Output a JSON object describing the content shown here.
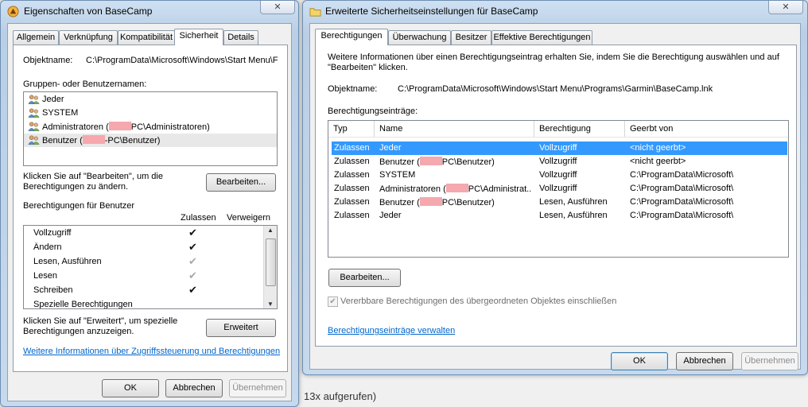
{
  "background": {
    "snippet": "13x aufgerufen)"
  },
  "props": {
    "title": "Eigenschaften von BaseCamp",
    "close": "✕",
    "tabs": [
      "Allgemein",
      "Verknüpfung",
      "Kompatibilität",
      "Sicherheit",
      "Details"
    ],
    "object_label": "Objektname:",
    "object_value": "C:\\ProgramData\\Microsoft\\Windows\\Start Menu\\F",
    "groups_label": "Gruppen- oder Benutzernamen:",
    "groups": [
      {
        "pre": "Jeder",
        "post": "",
        "redacted": false
      },
      {
        "pre": "SYSTEM",
        "post": "",
        "redacted": false
      },
      {
        "pre": "Administratoren (",
        "post": "PC\\Administratoren)",
        "redacted": true
      },
      {
        "pre": "Benutzer (",
        "post": "-PC\\Benutzer)",
        "redacted": true
      }
    ],
    "edit_hint": "Klicken Sie auf \"Bearbeiten\", um die Berechtigungen zu ändern.",
    "edit_button": "Bearbeiten...",
    "perm_label": "Berechtigungen für Benutzer",
    "col_allow": "Zulassen",
    "col_deny": "Verweigern",
    "perms": [
      {
        "name": "Vollzugriff",
        "check": "✔",
        "inherited": false
      },
      {
        "name": "Ändern",
        "check": "✔",
        "inherited": false
      },
      {
        "name": "Lesen, Ausführen",
        "check": "✔",
        "inherited": true
      },
      {
        "name": "Lesen",
        "check": "✔",
        "inherited": true
      },
      {
        "name": "Schreiben",
        "check": "✔",
        "inherited": false
      },
      {
        "name": "Spezielle Berechtigungen",
        "check": "",
        "inherited": false
      }
    ],
    "adv_hint": "Klicken Sie auf \"Erweitert\", um spezielle Berechtigungen anzuzeigen.",
    "adv_button": "Erweitert",
    "info_link": "Weitere Informationen über Zugriffssteuerung und Berechtigungen",
    "ok": "OK",
    "cancel": "Abbrechen",
    "apply": "Übernehmen"
  },
  "adv": {
    "title": "Erweiterte Sicherheitseinstellungen für BaseCamp",
    "close": "✕",
    "tabs": [
      "Berechtigungen",
      "Überwachung",
      "Besitzer",
      "Effektive Berechtigungen"
    ],
    "info": "Weitere Informationen über einen Berechtigungseintrag erhalten Sie, indem Sie die Berechtigung auswählen und auf \"Bearbeiten\" klicken.",
    "object_label": "Objektname:",
    "object_value": "C:\\ProgramData\\Microsoft\\Windows\\Start Menu\\Programs\\Garmin\\BaseCamp.lnk",
    "entries_label": "Berechtigungseinträge:",
    "columns": [
      "Typ",
      "Name",
      "Berechtigung",
      "Geerbt von"
    ],
    "rows": [
      {
        "type": "Zulassen",
        "name_pre": "Jeder",
        "name_post": "",
        "redacted": false,
        "perm": "Vollzugriff",
        "from": "<nicht geerbt>",
        "selected": true
      },
      {
        "type": "Zulassen",
        "name_pre": "Benutzer (",
        "name_post": "PC\\Benutzer)",
        "redacted": true,
        "perm": "Vollzugriff",
        "from": "<nicht geerbt>",
        "selected": false
      },
      {
        "type": "Zulassen",
        "name_pre": "SYSTEM",
        "name_post": "",
        "redacted": false,
        "perm": "Vollzugriff",
        "from": "C:\\ProgramData\\Microsoft\\",
        "selected": false
      },
      {
        "type": "Zulassen",
        "name_pre": "Administratoren (",
        "name_post": "PC\\Administrat...",
        "redacted": true,
        "perm": "Vollzugriff",
        "from": "C:\\ProgramData\\Microsoft\\",
        "selected": false
      },
      {
        "type": "Zulassen",
        "name_pre": "Benutzer (",
        "name_post": "PC\\Benutzer)",
        "redacted": true,
        "perm": "Lesen, Ausführen",
        "from": "C:\\ProgramData\\Microsoft\\",
        "selected": false
      },
      {
        "type": "Zulassen",
        "name_pre": "Jeder",
        "name_post": "",
        "redacted": false,
        "perm": "Lesen, Ausführen",
        "from": "C:\\ProgramData\\Microsoft\\",
        "selected": false
      }
    ],
    "edit_button": "Bearbeiten...",
    "inherit_checkbox": "Vererbbare Berechtigungen des übergeordneten Objektes einschließen",
    "manage_link": "Berechtigungseinträge verwalten",
    "ok": "OK",
    "cancel": "Abbrechen",
    "apply": "Übernehmen"
  }
}
